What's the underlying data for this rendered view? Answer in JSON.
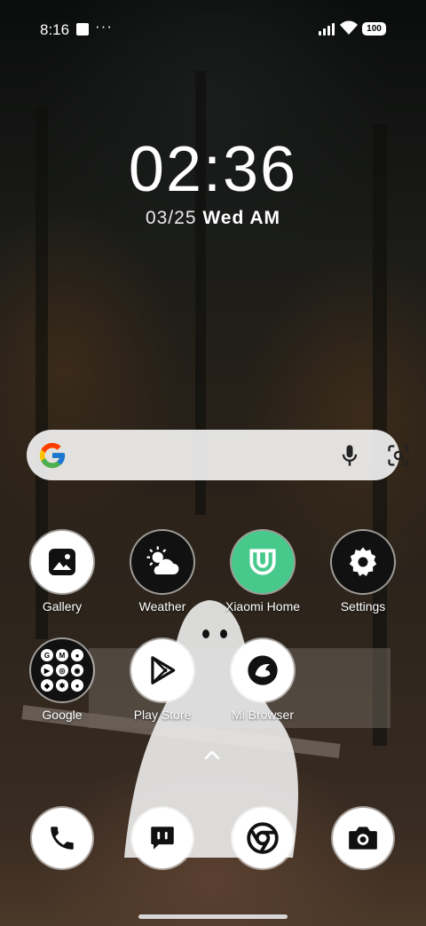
{
  "status_bar": {
    "time": "8:16",
    "overflow": "···",
    "battery": "100"
  },
  "clock": {
    "time": "02:36",
    "date": "03/25",
    "weekday": "Wed AM"
  },
  "search": {
    "icons": [
      "google-g-icon",
      "microphone-icon",
      "google-lens-icon"
    ]
  },
  "apps": {
    "gallery": "Gallery",
    "weather": "Weather",
    "xiaomi_home": "Xiaomi Home",
    "settings": "Settings",
    "google": "Google",
    "play_store": "Play Store",
    "mi_browser": "Mi Browser"
  },
  "google_folder": {
    "icons": [
      "G",
      "M",
      "●",
      "▶",
      "◎",
      "◉",
      "◆",
      "✱",
      "●"
    ]
  },
  "dock": {
    "icons": [
      "phone-icon",
      "messages-icon",
      "chrome-icon",
      "camera-icon"
    ]
  },
  "colors": {
    "xiaomi_green": "#46c98a",
    "search_bg": "#f0f0f0"
  }
}
